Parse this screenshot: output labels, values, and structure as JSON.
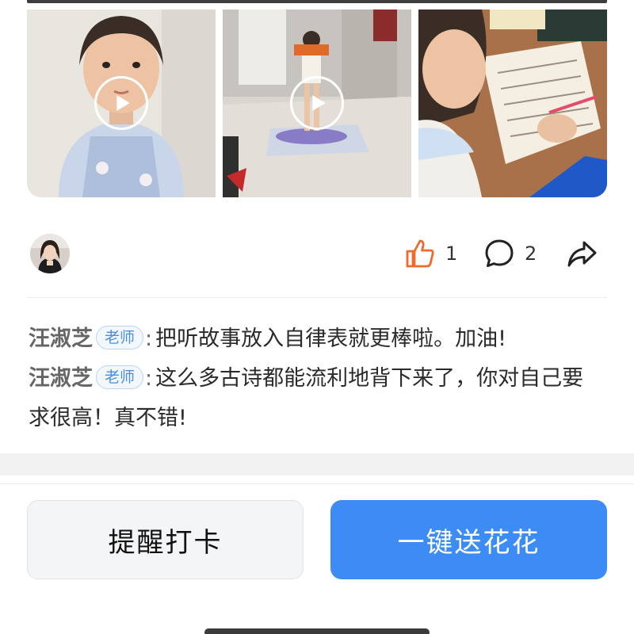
{
  "media": {
    "items": [
      {
        "kind": "video",
        "icon": "play-icon"
      },
      {
        "kind": "video",
        "icon": "play-icon"
      },
      {
        "kind": "image"
      }
    ]
  },
  "actions": {
    "like_count": "1",
    "comment_count": "2",
    "like_color": "#f06a2e"
  },
  "comments": [
    {
      "author": "汪淑芝",
      "badge": "老师",
      "separator": ":",
      "text": "把听故事放入自律表就更棒啦。加油!"
    },
    {
      "author": "汪淑芝",
      "badge": "老师",
      "separator": ":",
      "text": "这么多古诗都能流利地背下来了，你对自己要求很高！真不错!"
    }
  ],
  "buttons": {
    "remind_label": "提醒打卡",
    "send_label": "一键送花花",
    "send_color": "#3d8cf5"
  }
}
